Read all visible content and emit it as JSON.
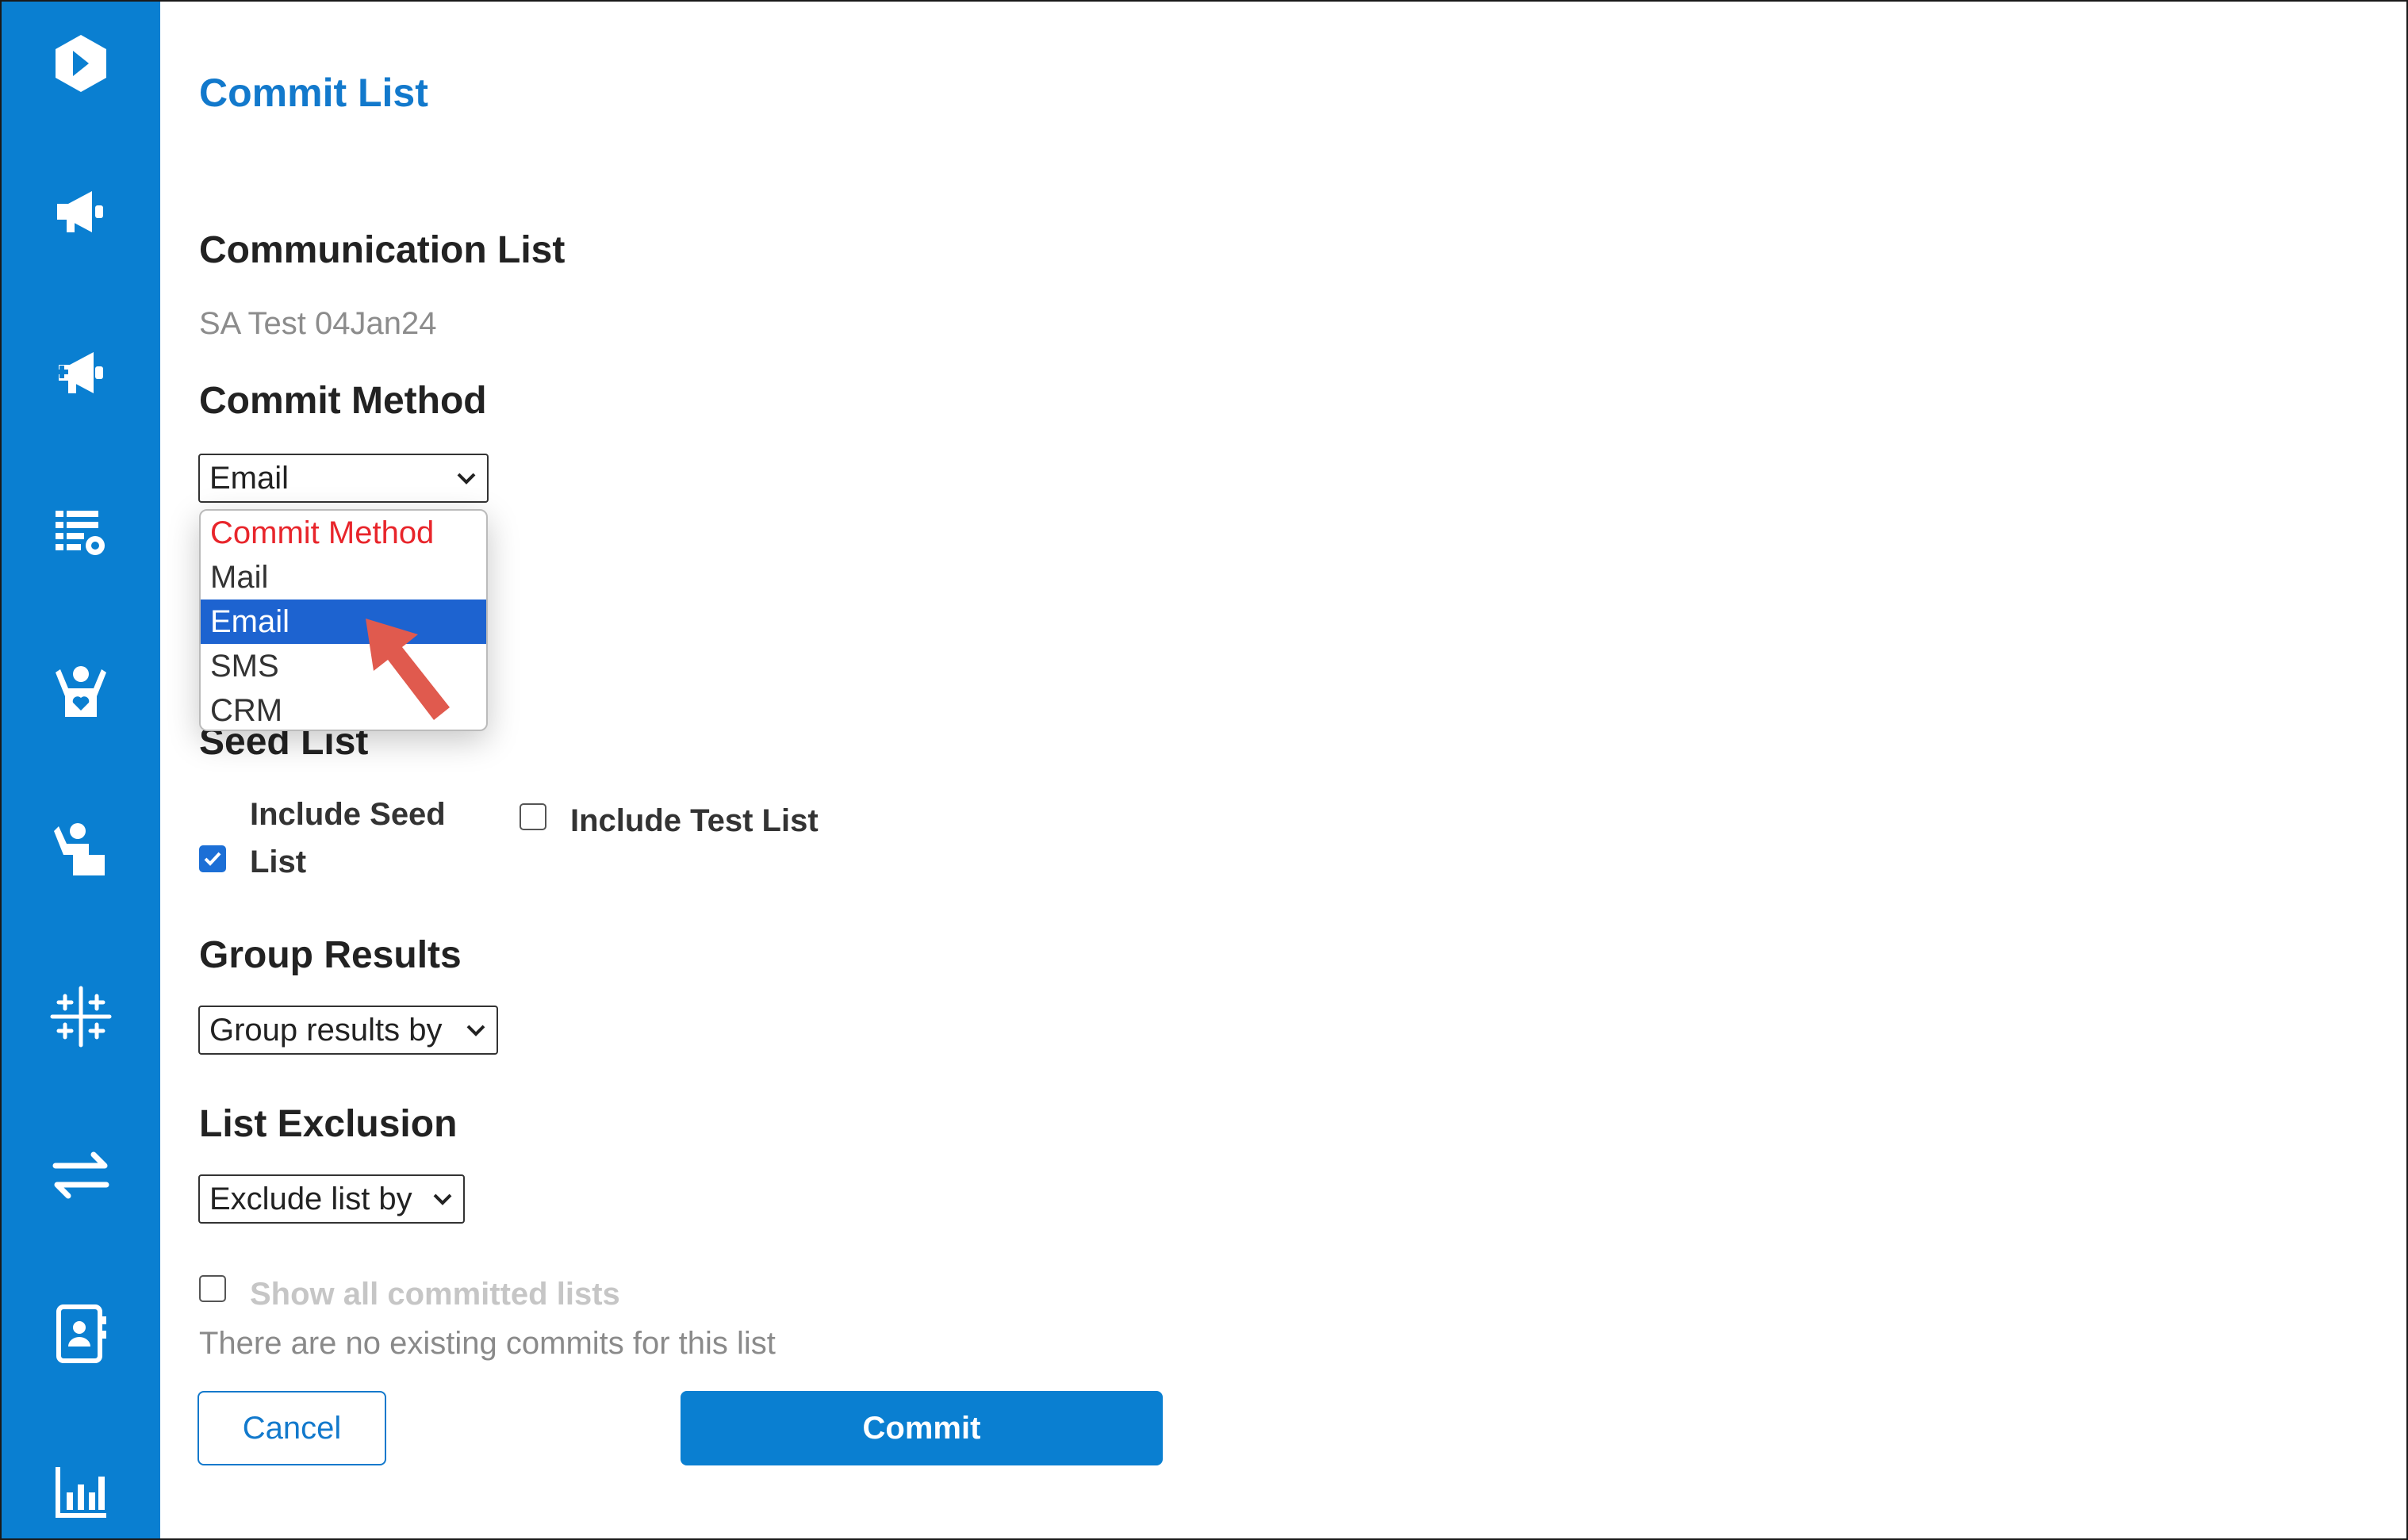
{
  "page": {
    "title": "Commit List"
  },
  "communication_list": {
    "heading": "Communication List",
    "value": "SA Test 04Jan24"
  },
  "commit_method": {
    "heading": "Commit Method",
    "selected": "Email",
    "options": [
      "Commit Method",
      "Mail",
      "Email",
      "SMS",
      "CRM"
    ]
  },
  "seed_list": {
    "heading": "Seed List",
    "include_seed_line1": "Include Seed",
    "include_seed_line2": "List",
    "include_seed_checked": true,
    "include_test_label": "Include Test List",
    "include_test_checked": false
  },
  "group_results": {
    "heading": "Group Results",
    "selected": "Group results by"
  },
  "list_exclusion": {
    "heading": "List Exclusion",
    "selected": "Exclude list by"
  },
  "committed": {
    "show_all_label": "Show all committed lists",
    "show_all_checked": false,
    "no_commits_text": "There are no existing commits for this list"
  },
  "actions": {
    "cancel_label": "Cancel",
    "commit_label": "Commit"
  },
  "sidebar": {
    "icons": [
      "app-logo-icon",
      "megaphone-icon",
      "megaphone-plus-icon",
      "list-settings-icon",
      "person-heart-icon",
      "person-desk-icon",
      "sparkle-grid-icon",
      "swap-arrows-icon",
      "contact-book-icon",
      "bar-chart-icon"
    ]
  },
  "colors": {
    "sidebar": "#0a7fd1",
    "accent": "#1279cc",
    "selected_option": "#1d63d0",
    "placeholder_option": "#e8252b",
    "annotation_arrow": "#e05a4e"
  }
}
